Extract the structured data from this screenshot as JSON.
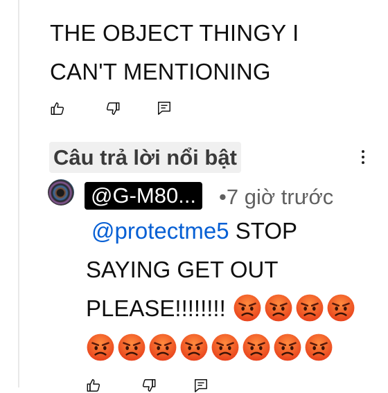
{
  "comment": {
    "line1": "THE OBJECT THINGY I",
    "line2": "CAN'T MENTIONING"
  },
  "actions": {
    "like_icon": "thumbs-up-icon",
    "dislike_icon": "thumbs-down-icon",
    "reply_icon": "reply-icon"
  },
  "highlighted_label": "Câu trả lời nổi bật",
  "menu_icon": "more-vertical-icon",
  "reply": {
    "author": "@G-M80...",
    "timestamp": "•7 giờ trước",
    "mention": "@protectme5",
    "text_1": "STOP",
    "text_2": "SAYING GET OUT",
    "text_3": "PLEASE!!!!!!!!",
    "emoji": "angry-face",
    "emoji_count_line1": 4,
    "emoji_count_line2": 8
  },
  "colors": {
    "mention": "#065fd4",
    "muted": "#606060",
    "pill_bg": "#f0f0f0",
    "handle_bg": "#000000"
  }
}
